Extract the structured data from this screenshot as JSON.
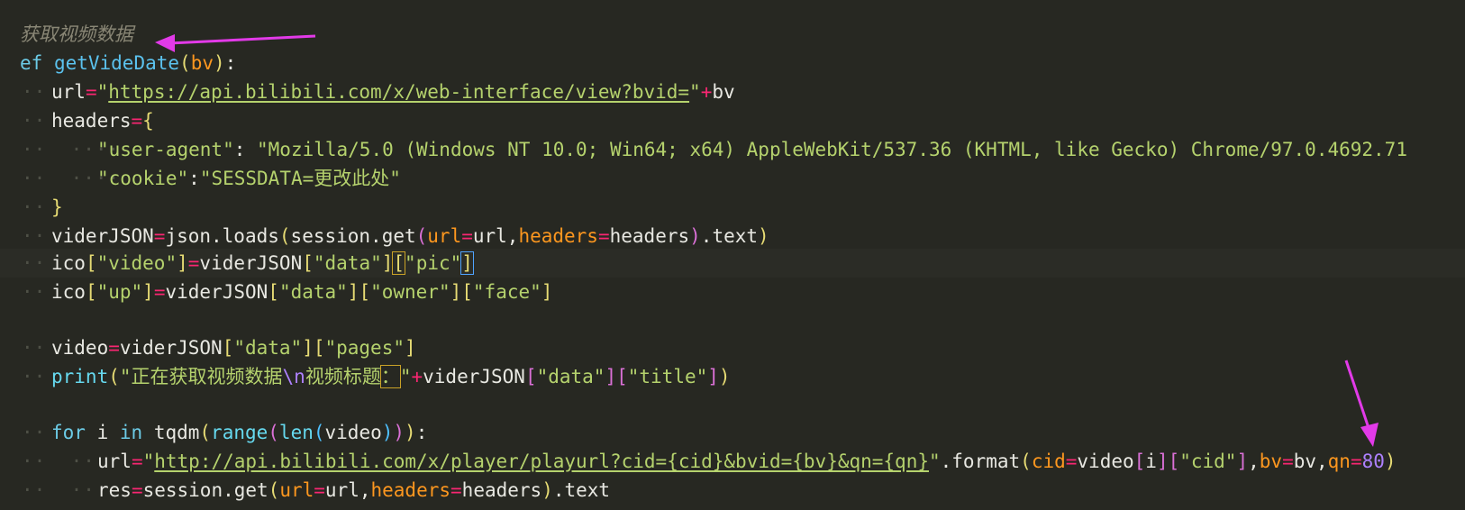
{
  "editor": {
    "comment": "获取视频数据",
    "def_kw": "ef",
    "func_name": "getVideDate",
    "param": "bv",
    "url_var": "url",
    "url_value": "https://api.bilibili.com/x/web-interface/view?bvid=",
    "concat_bv": "+bv",
    "headers_var": "headers",
    "ua_key": "\"user-agent\"",
    "ua_value": "\"Mozilla/5.0 (Windows NT 10.0; Win64; x64) AppleWebKit/537.36 (KHTML, like Gecko) Chrome/97.0.4692.71",
    "cookie_key": "\"cookie\"",
    "cookie_value": "\"SESSDATA=更改此处\"",
    "viderjson_line": "viderJSON=json.loads(session.get(url=url,headers=headers).text)",
    "ico_video_line": "ico[\"video\"]=viderJSON[\"data\"][\"pic\"]",
    "ico_up_line": "ico[\"up\"]=viderJSON[\"data\"][\"owner\"][\"face\"]",
    "video_line": "video=viderJSON[\"data\"][\"pages\"]",
    "print_str1": "\"正在获取视频数据",
    "print_esc": "\\n",
    "print_str2": "视频标题",
    "print_colon": "：",
    "print_str3": "\"",
    "print_rest": "+viderJSON[\"data\"][\"title\"])",
    "for_line": "for i in tqdm(range(len(video))):",
    "url2_value": "http://api.bilibili.com/x/player/playurl?cid={cid}&bvid={bv}&qn={qn}",
    "url2_rest": ".format(cid=video[i][\"cid\"],bv=bv,qn=80)",
    "res_line": "res=session.get(url=url,headers=headers).text"
  },
  "annotations": {
    "arrow_color": "#e23ae8"
  }
}
